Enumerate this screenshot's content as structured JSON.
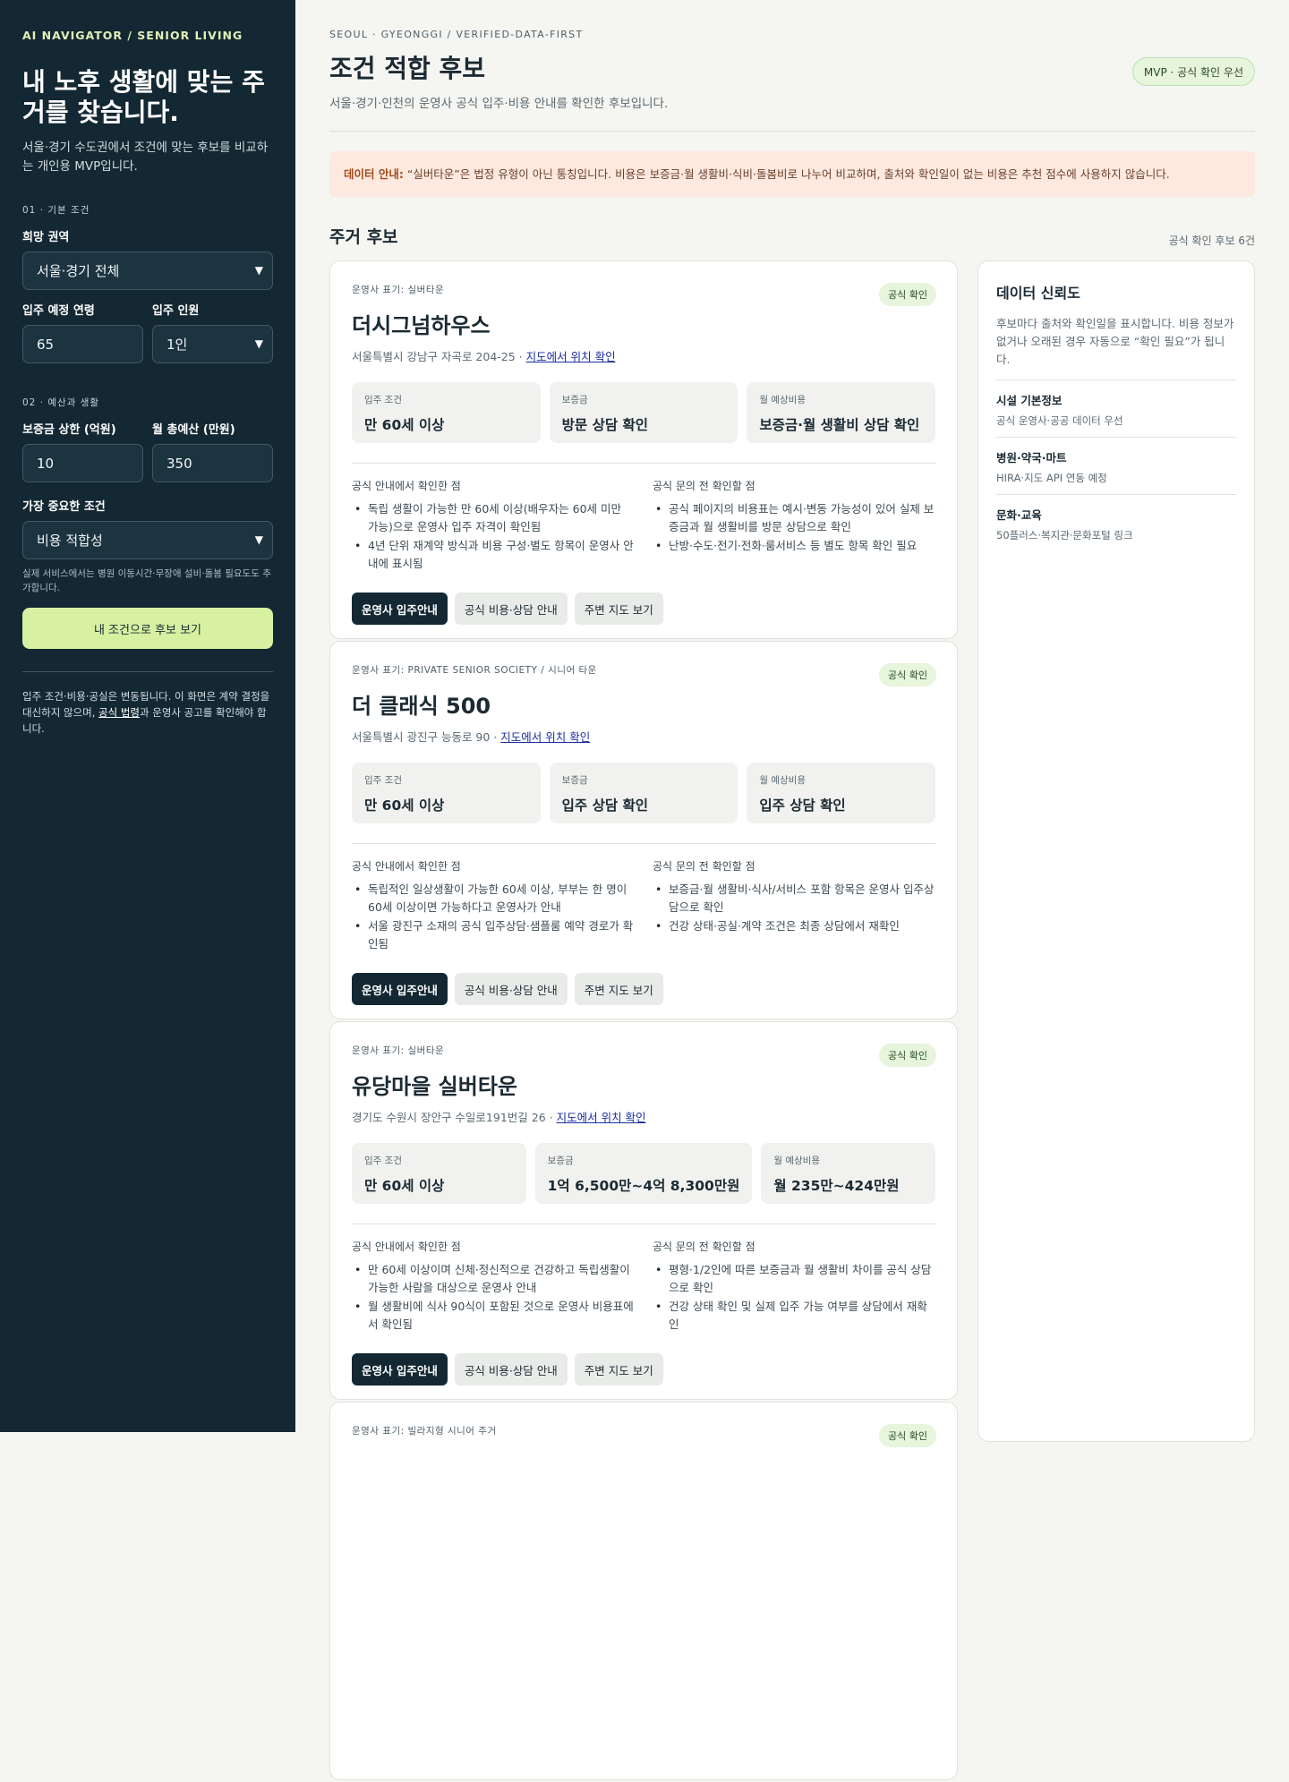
{
  "sidebar": {
    "brand": "AI NAVIGATOR / SENIOR LIVING",
    "title": "내 노후 생활에 맞는 주거를 찾습니다.",
    "desc": "서울·경기 수도권에서 조건에 맞는 후보를 비교하는 개인용 MVP입니다.",
    "section1": "01 · 기본 조건",
    "region_label": "희망 권역",
    "region_value": "서울·경기 전체",
    "age_label": "입주 예정 연령",
    "age_value": "65",
    "people_label": "입주 인원",
    "people_value": "1인",
    "section2": "02 · 예산과 생활",
    "deposit_label": "보증금 상한 (억원)",
    "deposit_value": "10",
    "monthly_label": "월 총예산 (만원)",
    "monthly_value": "350",
    "priority_label": "가장 중요한 조건",
    "priority_value": "비용 적합성",
    "hint": "실제 서비스에서는 병원 이동시간·무장애 설비·돌봄 필요도도 추가합니다.",
    "cta": "내 조건으로 후보 보기",
    "foot_pre": "입주 조건·비용·공실은 변동됩니다. 이 화면은 계약 결정을 대신하지 않으며, ",
    "foot_link": "공식 법령",
    "foot_post": "과 운영사 공고를 확인해야 합니다."
  },
  "header": {
    "crumb": "SEOUL · GYEONGGI / VERIFIED-DATA-FIRST",
    "title": "조건 적합 후보",
    "subtitle": "서울·경기·인천의 운영사 공식 입주·비용 안내를 확인한 후보입니다.",
    "badge": "MVP · 공식 확인 우선"
  },
  "notice": {
    "label": "데이터 안내:",
    "text": " “실버타운”은 법정 유형이 아닌 통칭입니다. 비용은 보증금·월 생활비·식비·돌봄비로 나누어 비교하며, 출처와 확인일이 없는 비용은 추천 점수에 사용하지 않습니다."
  },
  "list": {
    "title": "주거 후보",
    "count": "공식 확인 후보 6건"
  },
  "cards": [
    {
      "op": "운영사 표기: 실버타운",
      "badge": "공식 확인",
      "title": "더시그넘하우스",
      "addr": "서울특별시 강남구 자곡로 204-25 · ",
      "map_link": "지도에서 위치 확인",
      "facts": [
        {
          "k": "입주 조건",
          "v": "만 60세 이상"
        },
        {
          "k": "보증금",
          "v": "방문 상담 확인"
        },
        {
          "k": "월 예상비용",
          "v": "보증금·월 생활비 상담 확인"
        }
      ],
      "confirmed_h": "공식 안내에서 확인한 점",
      "confirmed": [
        "독립 생활이 가능한 만 60세 이상(배우자는 60세 미만 가능)으로 운영사 입주 자격이 확인됨",
        "4년 단위 재계약 방식과 비용 구성·별도 항목이 운영사 안내에 표시됨"
      ],
      "check_h": "공식 문의 전 확인할 점",
      "check": [
        "공식 페이지의 비용표는 예시·변동 가능성이 있어 실제 보증금과 월 생활비를 방문 상담으로 확인",
        "난방·수도·전기·전화·룸서비스 등 별도 항목 확인 필요"
      ],
      "buttons": [
        "운영사 입주안내",
        "공식 비용·상담 안내",
        "주변 지도 보기"
      ]
    },
    {
      "op": "운영사 표기: PRIVATE SENIOR SOCIETY / 시니어 타운",
      "badge": "공식 확인",
      "title": "더 클래식 500",
      "addr": "서울특별시 광진구 능동로 90 · ",
      "map_link": "지도에서 위치 확인",
      "facts": [
        {
          "k": "입주 조건",
          "v": "만 60세 이상"
        },
        {
          "k": "보증금",
          "v": "입주 상담 확인"
        },
        {
          "k": "월 예상비용",
          "v": "입주 상담 확인"
        }
      ],
      "confirmed_h": "공식 안내에서 확인한 점",
      "confirmed": [
        "독립적인 일상생활이 가능한 60세 이상, 부부는 한 명이 60세 이상이면 가능하다고 운영사가 안내",
        "서울 광진구 소재의 공식 입주상담·샘플룸 예약 경로가 확인됨"
      ],
      "check_h": "공식 문의 전 확인할 점",
      "check": [
        "보증금·월 생활비·식사/서비스 포함 항목은 운영사 입주상담으로 확인",
        "건강 상태·공실·계약 조건은 최종 상담에서 재확인"
      ],
      "buttons": [
        "운영사 입주안내",
        "공식 비용·상담 안내",
        "주변 지도 보기"
      ]
    },
    {
      "op": "운영사 표기: 실버타운",
      "badge": "공식 확인",
      "title": "유당마을 실버타운",
      "addr": "경기도 수원시 장안구 수일로191번길 26 · ",
      "map_link": "지도에서 위치 확인",
      "facts": [
        {
          "k": "입주 조건",
          "v": "만 60세 이상"
        },
        {
          "k": "보증금",
          "v": "1억 6,500만~4억 8,300만원"
        },
        {
          "k": "월 예상비용",
          "v": "월 235만~424만원"
        }
      ],
      "confirmed_h": "공식 안내에서 확인한 점",
      "confirmed": [
        "만 60세 이상이며 신체·정신적으로 건강하고 독립생활이 가능한 사람을 대상으로 운영사 안내",
        "월 생활비에 식사 90식이 포함된 것으로 운영사 비용표에서 확인됨"
      ],
      "check_h": "공식 문의 전 확인할 점",
      "check": [
        "평형·1/2인에 따른 보증금과 월 생활비 차이를 공식 상담으로 확인",
        "건강 상태 확인 및 실제 입주 가능 여부를 상담에서 재확인"
      ],
      "buttons": [
        "운영사 입주안내",
        "공식 비용·상담 안내",
        "주변 지도 보기"
      ]
    },
    {
      "op": "운영사 표기: 빌라지형 시니어 주거",
      "badge": "공식 확인"
    }
  ],
  "aside": {
    "title": "데이터 신뢰도",
    "desc": "후보마다 출처와 확인일을 표시합니다. 비용 정보가 없거나 오래된 경우 자동으로 “확인 필요”가 됩니다.",
    "items": [
      {
        "h": "시설 기본정보",
        "v": "공식 운영사·공공 데이터 우선"
      },
      {
        "h": "병원·약국·마트",
        "v": "HIRA·지도 API 연동 예정"
      },
      {
        "h": "문화·교육",
        "v": "50플러스·복지관·문화포털 링크"
      }
    ]
  },
  "icons": {
    "select_chevron": "chevron-down-icon"
  }
}
